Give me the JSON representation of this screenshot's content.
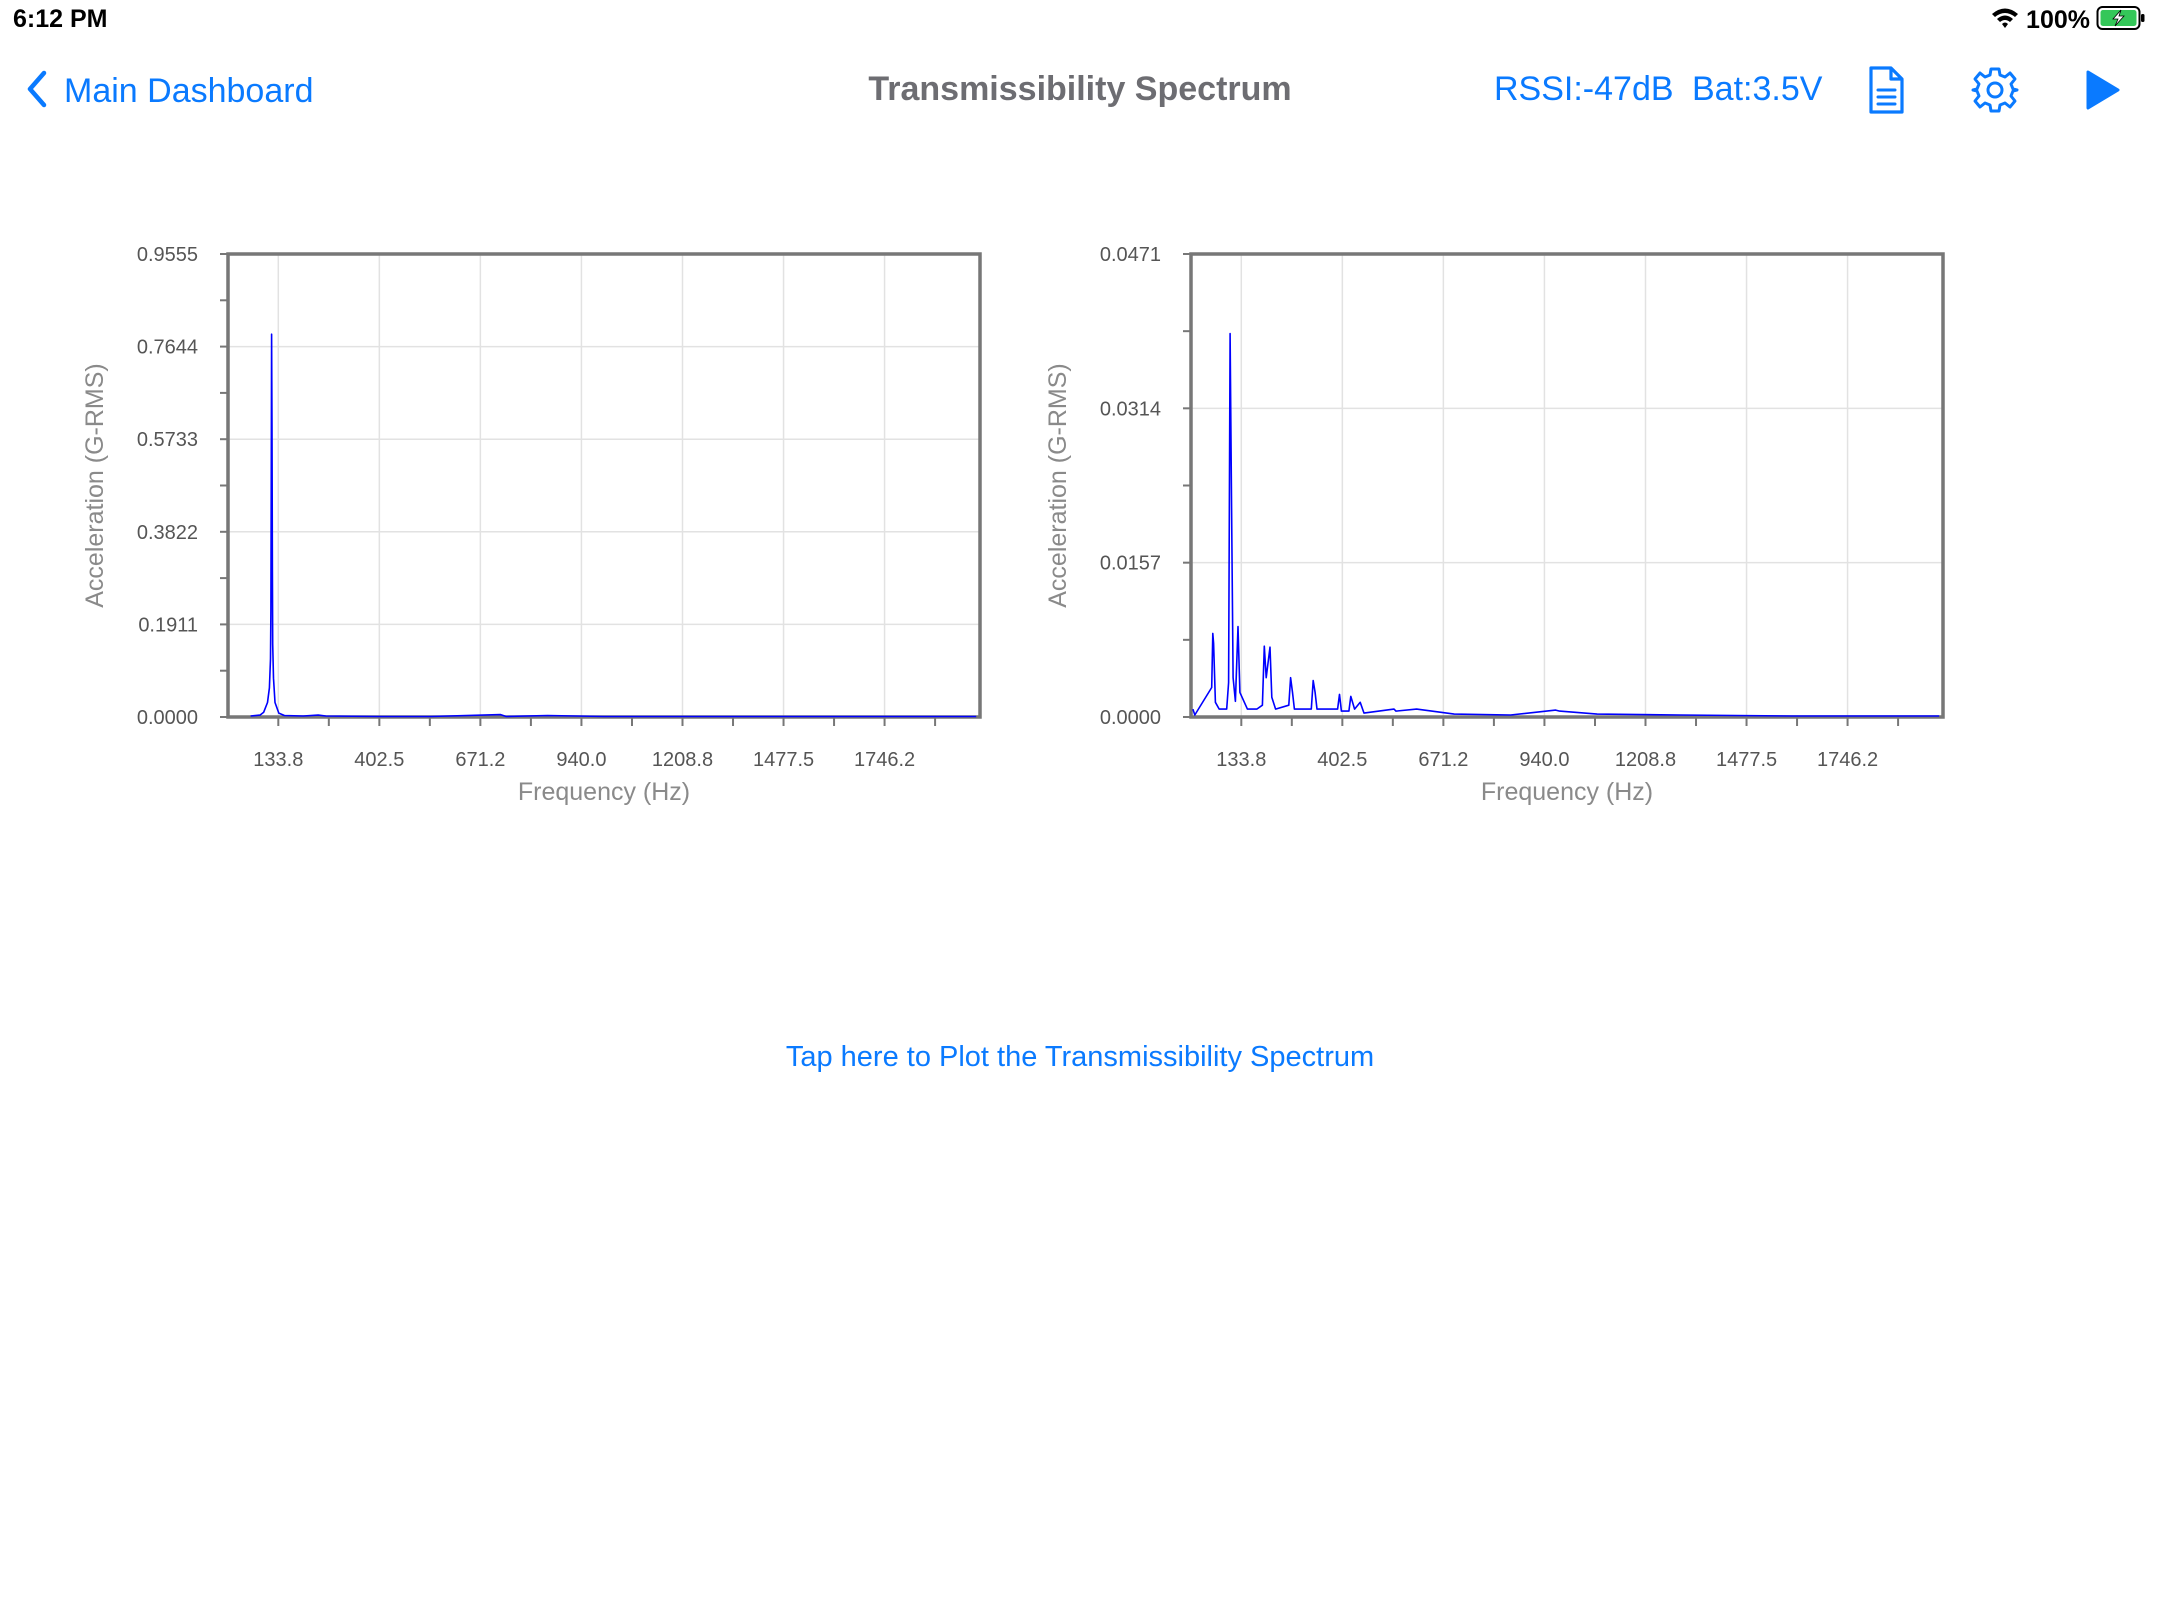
{
  "status": {
    "time": "6:12 PM",
    "battery_pct": "100%"
  },
  "nav": {
    "back_label": "Main Dashboard",
    "title": "Transmissibility Spectrum",
    "rssi": "RSSI:-47dB",
    "battery": "Bat:3.5V",
    "icons": [
      "document-icon",
      "gear-icon",
      "play-icon"
    ]
  },
  "colors": {
    "accent": "#0a7aff",
    "series": "#0000ff",
    "title_gray": "#6d6d72"
  },
  "chart_data": [
    {
      "type": "line",
      "title": "",
      "xlabel": "Frequency (Hz)",
      "ylabel": "Acceleration (G-RMS)",
      "x_ticks": [
        "133.8",
        "402.5",
        "671.2",
        "940.0",
        "1208.8",
        "1477.5",
        "1746.2"
      ],
      "y_ticks": [
        "0.0000",
        "0.1911",
        "0.3822",
        "0.5733",
        "0.7644",
        "0.9555"
      ],
      "xlim": [
        0,
        2000
      ],
      "ylim": [
        0,
        0.9555
      ],
      "grid": true,
      "series": [
        {
          "points": [
            [
              60,
              0.002
            ],
            [
              85,
              0.004
            ],
            [
              95,
              0.01
            ],
            [
              105,
              0.03
            ],
            [
              110,
              0.06
            ],
            [
              113,
              0.12
            ],
            [
              114,
              0.22
            ],
            [
              115,
              0.45
            ],
            [
              116,
              0.79
            ],
            [
              117,
              0.6
            ],
            [
              118,
              0.3
            ],
            [
              119,
              0.15
            ],
            [
              121,
              0.08
            ],
            [
              125,
              0.03
            ],
            [
              135,
              0.008
            ],
            [
              150,
              0.003
            ],
            [
              200,
              0.002
            ],
            [
              240,
              0.004
            ],
            [
              260,
              0.002
            ],
            [
              400,
              0.001
            ],
            [
              540,
              0.001
            ],
            [
              725,
              0.005
            ],
            [
              740,
              0.001
            ],
            [
              850,
              0.003
            ],
            [
              1000,
              0.001
            ],
            [
              1500,
              0.001
            ],
            [
              1990,
              0.001
            ]
          ]
        }
      ]
    },
    {
      "type": "line",
      "title": "",
      "xlabel": "Frequency (Hz)",
      "ylabel": "Acceleration (G-RMS)",
      "x_ticks": [
        "133.8",
        "402.5",
        "671.2",
        "940.0",
        "1208.8",
        "1477.5",
        "1746.2"
      ],
      "y_ticks": [
        "0.0000",
        "0.0157",
        "0.0314",
        "0.0471"
      ],
      "xlim": [
        0,
        2000
      ],
      "ylim": [
        0,
        0.0471
      ],
      "grid": true,
      "series": [
        {
          "points": [
            [
              5,
              0.0008
            ],
            [
              10,
              0.0002
            ],
            [
              55,
              0.003
            ],
            [
              58,
              0.0085
            ],
            [
              60,
              0.0075
            ],
            [
              65,
              0.0015
            ],
            [
              75,
              0.0008
            ],
            [
              95,
              0.0008
            ],
            [
              100,
              0.0035
            ],
            [
              104,
              0.039
            ],
            [
              108,
              0.021
            ],
            [
              112,
              0.004
            ],
            [
              118,
              0.0016
            ],
            [
              125,
              0.0092
            ],
            [
              130,
              0.0025
            ],
            [
              150,
              0.0008
            ],
            [
              175,
              0.0008
            ],
            [
              190,
              0.0012
            ],
            [
              195,
              0.0072
            ],
            [
              200,
              0.004
            ],
            [
              210,
              0.0071
            ],
            [
              215,
              0.002
            ],
            [
              225,
              0.0008
            ],
            [
              260,
              0.0012
            ],
            [
              265,
              0.004
            ],
            [
              270,
              0.0025
            ],
            [
              275,
              0.0008
            ],
            [
              320,
              0.0008
            ],
            [
              325,
              0.0037
            ],
            [
              330,
              0.0025
            ],
            [
              335,
              0.0008
            ],
            [
              390,
              0.0008
            ],
            [
              395,
              0.0023
            ],
            [
              400,
              0.0006
            ],
            [
              420,
              0.0006
            ],
            [
              425,
              0.0021
            ],
            [
              435,
              0.0008
            ],
            [
              450,
              0.0015
            ],
            [
              460,
              0.0004
            ],
            [
              540,
              0.0008
            ],
            [
              545,
              0.0006
            ],
            [
              600,
              0.0008
            ],
            [
              700,
              0.0003
            ],
            [
              850,
              0.0002
            ],
            [
              970,
              0.0007
            ],
            [
              980,
              0.0006
            ],
            [
              1080,
              0.0003
            ],
            [
              1300,
              0.0002
            ],
            [
              1600,
              0.0001
            ],
            [
              1990,
              0.0001
            ]
          ]
        }
      ]
    }
  ],
  "plot_link": "Tap here to Plot the Transmissibility Spectrum"
}
